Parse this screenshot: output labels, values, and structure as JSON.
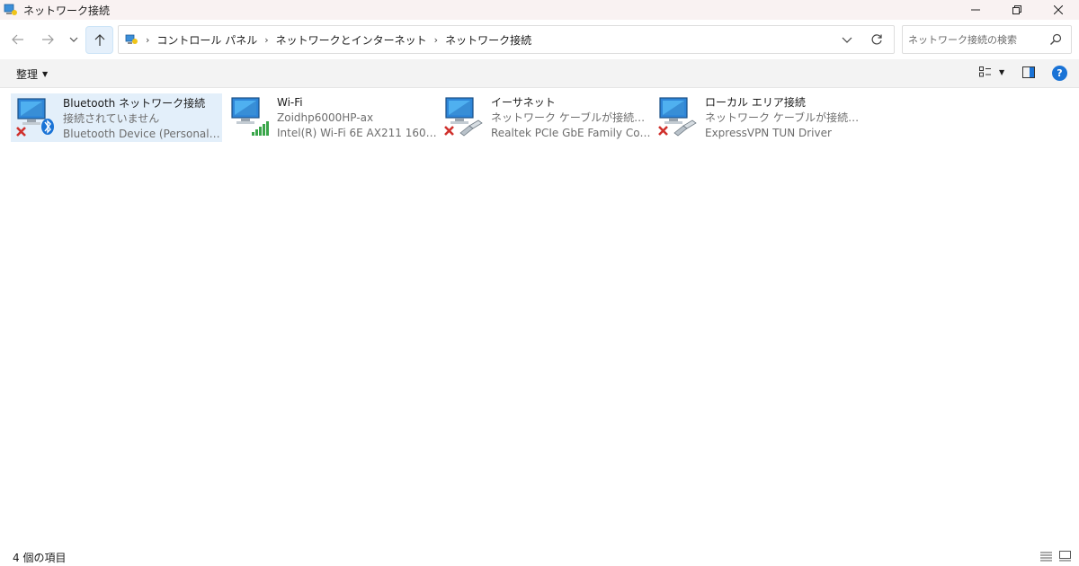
{
  "window": {
    "title": "ネットワーク接続"
  },
  "address_bar": {
    "breadcrumbs": [
      "コントロール パネル",
      "ネットワークとインターネット",
      "ネットワーク接続"
    ],
    "search_placeholder": "ネットワーク接続の検索"
  },
  "command_bar": {
    "organize_label": "整理",
    "help_label": "?"
  },
  "connections": [
    {
      "name": "Bluetooth ネットワーク接続",
      "status": "接続されていません",
      "device": "Bluetooth Device (Personal Area ...",
      "icon": "bluetooth-network-icon",
      "disconnected": true,
      "selected": true
    },
    {
      "name": "Wi-Fi",
      "status": "Zoidhp6000HP-ax",
      "device": "Intel(R) Wi-Fi 6E AX211 160MHz",
      "icon": "wifi-network-icon",
      "disconnected": false,
      "selected": false
    },
    {
      "name": "イーサネット",
      "status": "ネットワーク ケーブルが接続されていま...",
      "device": "Realtek PCIe GbE Family Controller",
      "icon": "ethernet-network-icon",
      "disconnected": true,
      "selected": false
    },
    {
      "name": "ローカル エリア接続",
      "status": "ネットワーク ケーブルが接続されていま...",
      "device": "ExpressVPN TUN Driver",
      "icon": "local-area-network-icon",
      "disconnected": true,
      "selected": false
    }
  ],
  "status_bar": {
    "item_count": "4 個の項目"
  },
  "colors": {
    "selection": "#e3effa",
    "help": "#1a73d6",
    "disconnected_x": "#d0312d",
    "signal": "#3aa64a"
  }
}
